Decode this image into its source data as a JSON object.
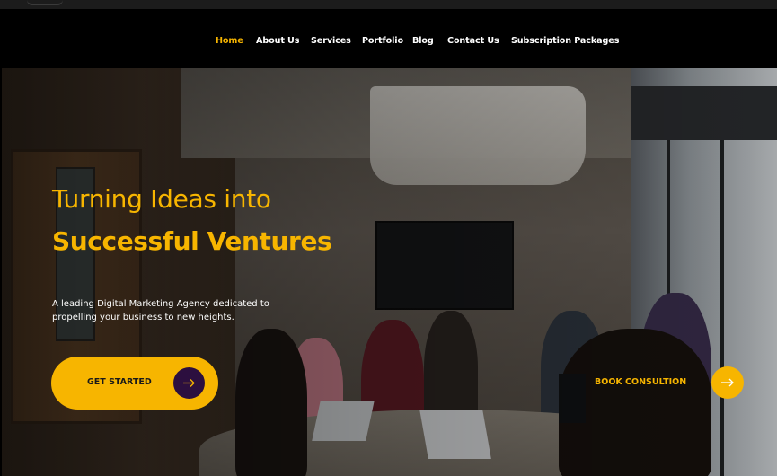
{
  "nav": {
    "items": [
      {
        "label": "Home",
        "active": true
      },
      {
        "label": "About Us",
        "active": false
      },
      {
        "label": "Services",
        "active": false
      },
      {
        "label": "Portfolio",
        "active": false
      },
      {
        "label": "Blog",
        "active": false
      },
      {
        "label": "Contact Us",
        "active": false
      },
      {
        "label": "Subscription Packages",
        "active": false
      }
    ]
  },
  "hero": {
    "title_line1": "Turning Ideas into",
    "title_line2": "Successful Ventures",
    "subtitle": "A leading Digital Marketing Agency dedicated to propelling your business to new heights.",
    "primary_button": {
      "label": "GET STARTED",
      "icon": "arrow-right-icon"
    },
    "secondary_button": {
      "label": "BOOK CONSULTION",
      "icon": "arrow-right-icon"
    }
  },
  "colors": {
    "accent": "#f7b500",
    "dark_purple": "#2c0f3f",
    "background": "#000000",
    "text": "#ffffff"
  }
}
